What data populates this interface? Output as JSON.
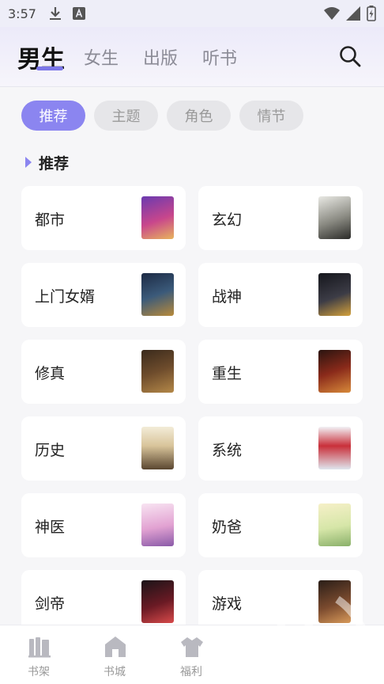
{
  "status_bar": {
    "time": "3:57",
    "left_icons": [
      "download-icon",
      "keyboard-a-icon"
    ],
    "right_icons": [
      "wifi-icon",
      "signal-icon",
      "battery-icon"
    ]
  },
  "header": {
    "tabs": [
      {
        "label": "男生"
      },
      {
        "label": "女生"
      },
      {
        "label": "出版"
      },
      {
        "label": "听书"
      }
    ],
    "active_tab": "男生",
    "search_icon": "search-icon"
  },
  "filters": {
    "chips": [
      {
        "label": "推荐"
      },
      {
        "label": "主题"
      },
      {
        "label": "角色"
      },
      {
        "label": "情节"
      }
    ],
    "active_chip": "推荐"
  },
  "section": {
    "title": "推荐"
  },
  "categories": [
    {
      "name": "都市",
      "cover_text": ""
    },
    {
      "name": "玄幻",
      "cover_text": ""
    },
    {
      "name": "上门女婿",
      "cover_text": ""
    },
    {
      "name": "战神",
      "cover_text": ""
    },
    {
      "name": "修真",
      "cover_text": ""
    },
    {
      "name": "重生",
      "cover_text": ""
    },
    {
      "name": "历史",
      "cover_text": ""
    },
    {
      "name": "系统",
      "cover_text": ""
    },
    {
      "name": "神医",
      "cover_text": ""
    },
    {
      "name": "奶爸",
      "cover_text": ""
    },
    {
      "name": "剑帝",
      "cover_text": ""
    },
    {
      "name": "游戏",
      "cover_text": ""
    }
  ],
  "bottom_nav": [
    {
      "label": "书架",
      "icon": "bookshelf-icon"
    },
    {
      "label": "书城",
      "icon": "bookstore-icon"
    },
    {
      "label": "福利",
      "icon": "gift-shirt-icon"
    }
  ],
  "colors": {
    "accent": "#8b85f0",
    "chip_inactive": "#e6e6e9",
    "background": "#f6f6f8"
  }
}
